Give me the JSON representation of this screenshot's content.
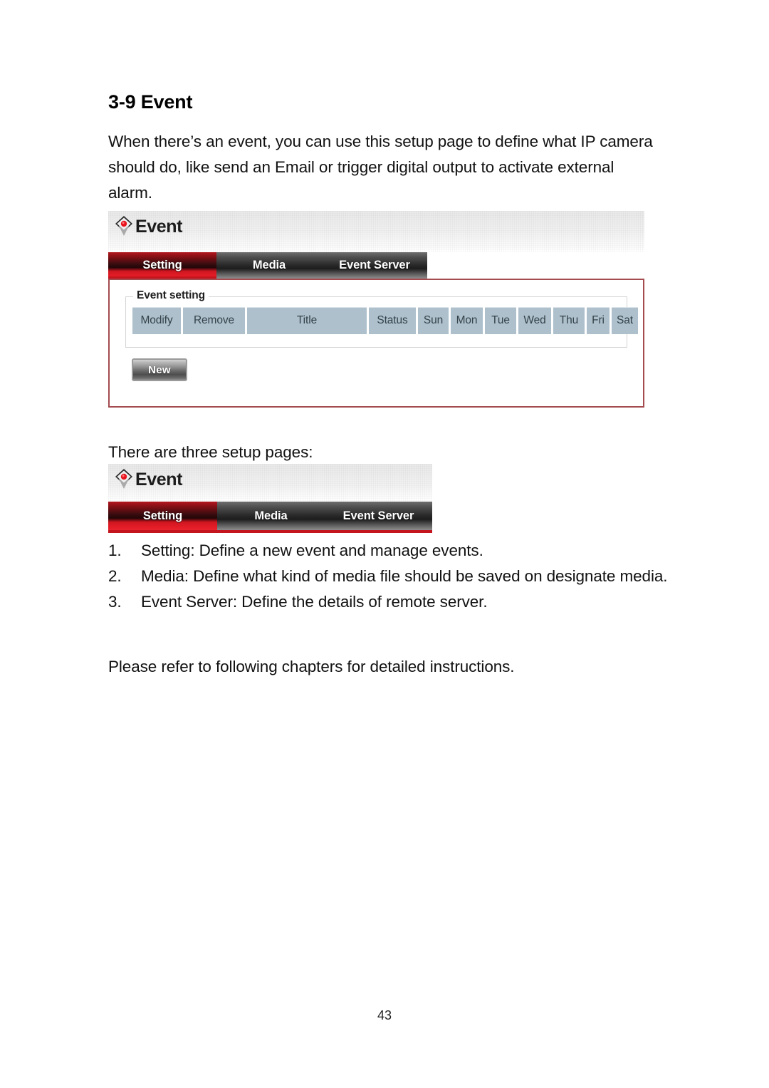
{
  "document": {
    "heading": "3-9 Event",
    "intro_paragraph": "When there’s an event, you can use this setup page to define what IP camera should do, like send an Email or trigger digital output to activate external alarm.",
    "mid_paragraph": "There are three setup pages:",
    "closing_paragraph": "Please refer to following chapters for detailed instructions.",
    "page_number": "43"
  },
  "setup_pages_list": [
    {
      "number": "1.",
      "text": "Setting: Define a new event and manage events."
    },
    {
      "number": "2.",
      "text": "Media: Define what kind of media file should be saved on designate media."
    },
    {
      "number": "3.",
      "text": "Event Server: Define the details of remote server."
    }
  ],
  "screenshot_full": {
    "logo_icon": "event-diamond-icon",
    "title": "Event",
    "tabs": [
      {
        "label": "Setting",
        "active": true
      },
      {
        "label": "Media",
        "active": false
      },
      {
        "label": "Event Server",
        "active": false
      }
    ],
    "fieldset_legend": "Event setting",
    "table_headers": [
      "Modify",
      "Remove",
      "Title",
      "Status",
      "Sun",
      "Mon",
      "Tue",
      "Wed",
      "Thu",
      "Fri",
      "Sat"
    ],
    "new_button_label": "New"
  },
  "screenshot_tabs_only": {
    "logo_icon": "event-diamond-icon",
    "title": "Event",
    "tabs": [
      {
        "label": "Setting",
        "active": true
      },
      {
        "label": "Media",
        "active": false
      },
      {
        "label": "Event Server",
        "active": false
      }
    ]
  },
  "colors": {
    "accent_red": "#c4141d",
    "tab_inactive_gray": "#2a2a2a",
    "table_header_blue_gray": "#adc0cc",
    "pane_border": "#a34b4f"
  }
}
